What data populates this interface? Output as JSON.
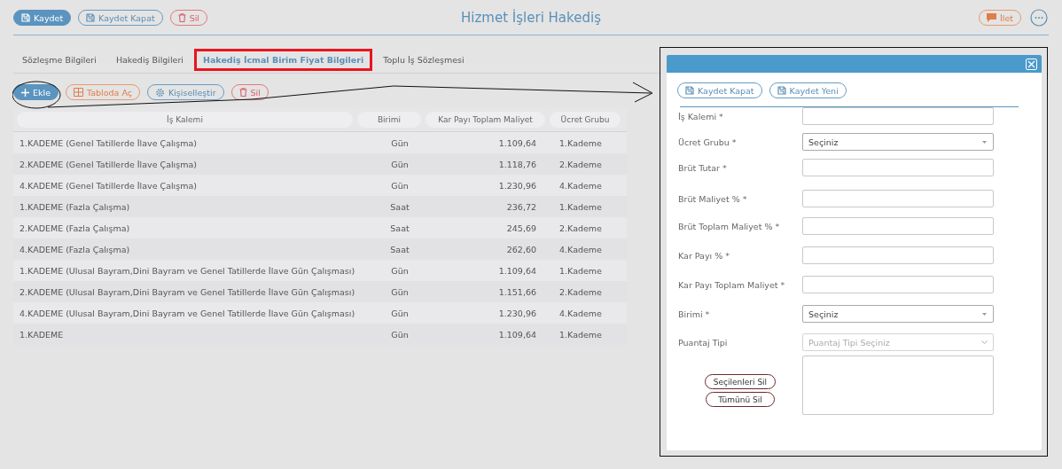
{
  "toolbar": {
    "buttons": [
      {
        "label": "Kaydet",
        "kind": "primary"
      },
      {
        "label": "Kaydet Kapat",
        "kind": "outline"
      },
      {
        "label": "Sil",
        "kind": "danger"
      }
    ]
  },
  "title": "Hizmet İşleri Hakediş",
  "actions": [
    {
      "label": "İlet",
      "kind": "forward"
    }
  ],
  "tabs": [
    {
      "label": "Sözleşme Bilgileri",
      "selected": false
    },
    {
      "label": "Hakediş Bilgileri",
      "selected": false
    },
    {
      "label": "Hakediş İcmal Birim Fiyat Bilgileri",
      "selected": true
    },
    {
      "label": "Toplu İş Sözleşmesi",
      "selected": false
    }
  ],
  "grid_toolbar": [
    {
      "label": "Ekle",
      "kind": "primary"
    },
    {
      "label": "Tabloda Aç",
      "kind": "warning"
    },
    {
      "label": "Kişiselleştir",
      "kind": "outline"
    },
    {
      "label": "Sil",
      "kind": "danger"
    }
  ],
  "table": {
    "columns": [
      "İş Kalemi",
      "Birimi",
      "Kar Payı Toplam Maliyet",
      "Ücret Grubu"
    ],
    "rows": [
      [
        "1.KADEME (Genel Tatillerde İlave Çalışma)",
        "Gün",
        "1.109,64",
        "1.Kademe"
      ],
      [
        "2.KADEME (Genel Tatillerde İlave Çalışma)",
        "Gün",
        "1.118,76",
        "2.Kademe"
      ],
      [
        "4.KADEME (Genel Tatillerde İlave Çalışma)",
        "Gün",
        "1.230,96",
        "4.Kademe"
      ],
      [
        "1.KADEME (Fazla Çalışma)",
        "Saat",
        "236,72",
        "1.Kademe"
      ],
      [
        "2.KADEME (Fazla Çalışma)",
        "Saat",
        "245,69",
        "2.Kademe"
      ],
      [
        "4.KADEME (Fazla Çalışma)",
        "Saat",
        "262,60",
        "4.Kademe"
      ],
      [
        "1.KADEME (Ulusal Bayram,Dini Bayram ve Genel Tatillerde İlave Gün Çalışması)",
        "Gün",
        "1.109,64",
        "1.Kademe"
      ],
      [
        "2.KADEME (Ulusal Bayram,Dini Bayram ve Genel Tatillerde İlave Gün Çalışması)",
        "Gün",
        "1.151,66",
        "2.Kademe"
      ],
      [
        "4.KADEME (Ulusal Bayram,Dini Bayram ve Genel Tatillerde İlave Gün Çalışması)",
        "Gün",
        "1.230,96",
        "4.Kademe"
      ],
      [
        "1.KADEME",
        "Gün",
        "1.109,64",
        "1.Kademe"
      ]
    ]
  },
  "modal": {
    "buttons": [
      "Kaydet Kapat",
      "Kaydet Yeni"
    ],
    "fields": [
      {
        "label": "İş Kalemi *",
        "kind": "text",
        "disabled": false
      },
      {
        "label": "Ücret Grubu *",
        "kind": "select",
        "value": "Seçiniz",
        "disabled": false
      },
      {
        "label": "Brüt Tutar *",
        "kind": "text",
        "disabled": false
      },
      {
        "label": "Brüt Maliyet % *",
        "kind": "text",
        "disabled": false
      },
      {
        "label": "Brüt Toplam Maliyet % *",
        "kind": "text",
        "disabled": false
      },
      {
        "label": "Kar Payı % *",
        "kind": "text",
        "disabled": false
      },
      {
        "label": "Kar Payı Toplam Maliyet *",
        "kind": "text",
        "disabled": false
      },
      {
        "label": "Birimi *",
        "kind": "select",
        "value": "Seçiniz",
        "disabled": false
      },
      {
        "label": "Puantaj Tipi",
        "kind": "select",
        "placeholder": "Puantaj Tipi Seçiniz",
        "disabled": true
      }
    ],
    "list_buttons": [
      "Seçilenleri Sil",
      "Tümünü Sil"
    ]
  }
}
